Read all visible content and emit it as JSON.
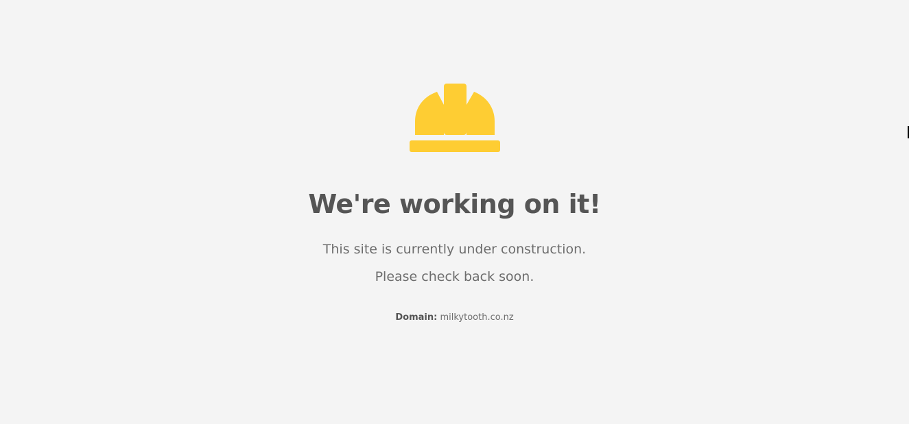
{
  "page": {
    "background": "#f4f4f4",
    "accent": "#fecd33",
    "icon": "hard-hat-icon"
  },
  "main": {
    "title": "We're working on it!",
    "message_line1": "This site is currently under construction.",
    "message_line2": "Please check back soon.",
    "domain_label": "Domain:",
    "domain_value": "milkytooth.co.nz"
  }
}
